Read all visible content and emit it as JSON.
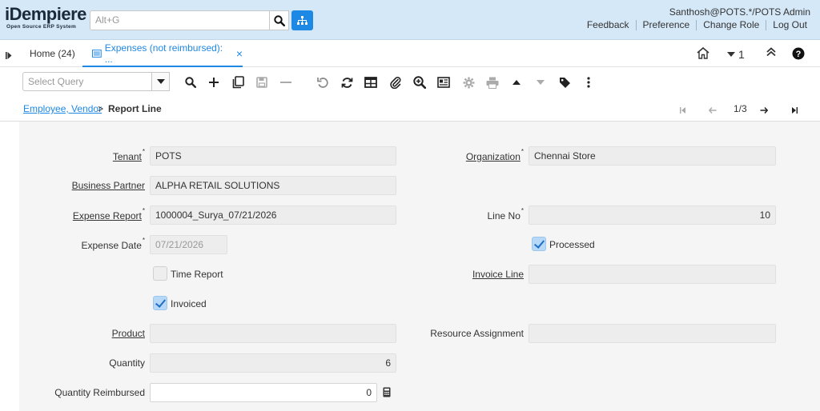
{
  "header": {
    "logo_main": "iDempiere",
    "logo_sub": "Open Source ERP System",
    "search_placeholder": "Alt+G",
    "user": "Santhosh@POTS.*/POTS Admin",
    "links": [
      "Feedback",
      "Preference",
      "Change Role",
      "Log Out"
    ]
  },
  "tabs": {
    "home_label": "Home (24)",
    "active_label": "Expenses (not reimbursed): ...",
    "close_glyph": "×",
    "window_count": "1"
  },
  "toolbar": {
    "query_placeholder": "Select Query"
  },
  "breadcrumb": {
    "parent": "Employee, Vendor",
    "separator": ">",
    "current": "Report Line",
    "record_nav": "1/3"
  },
  "form": {
    "tenant": {
      "label": "Tenant",
      "value": "POTS"
    },
    "organization": {
      "label": "Organization",
      "value": "Chennai Store"
    },
    "business_partner": {
      "label": "Business Partner",
      "value": "ALPHA RETAIL SOLUTIONS"
    },
    "expense_report": {
      "label": "Expense Report",
      "value": "1000004_Surya_07/21/2026"
    },
    "line_no": {
      "label": "Line No",
      "value": "10"
    },
    "expense_date": {
      "label": "Expense Date",
      "value": "07/21/2026"
    },
    "processed": {
      "label": "Processed",
      "checked": true
    },
    "time_report": {
      "label": "Time Report",
      "checked": false
    },
    "invoice_line": {
      "label": "Invoice Line",
      "value": ""
    },
    "invoiced": {
      "label": "Invoiced",
      "checked": true
    },
    "product": {
      "label": "Product",
      "value": ""
    },
    "resource_assignment": {
      "label": "Resource Assignment",
      "value": ""
    },
    "quantity": {
      "label": "Quantity",
      "value": "6"
    },
    "quantity_reimbursed": {
      "label": "Quantity Reimbursed",
      "value": "0"
    },
    "required_mark": "*"
  },
  "colors": {
    "header_bg": "#d5e8f8",
    "accent": "#1e88e5",
    "form_bg": "#f5f5f5"
  }
}
